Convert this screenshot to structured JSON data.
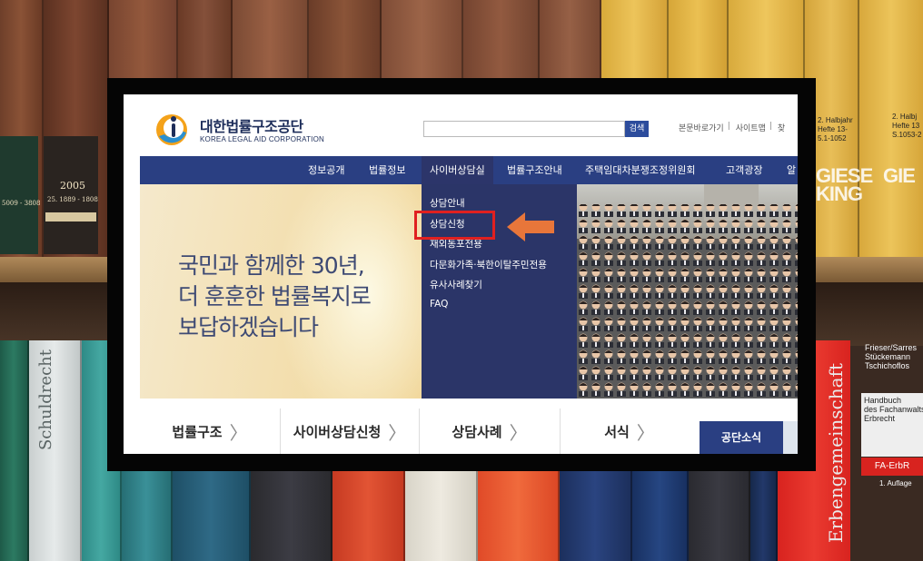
{
  "site": {
    "name_kr": "대한법률구조공단",
    "name_en": "KOREA LEGAL AID CORPORATION"
  },
  "search": {
    "button_label": "검색",
    "placeholder": ""
  },
  "util_links": [
    "본문바로가기",
    "사이트맵",
    "찾"
  ],
  "nav": [
    {
      "label": "정보공개"
    },
    {
      "label": "법률정보"
    },
    {
      "label": "사이버상담실",
      "active": true
    },
    {
      "label": "법률구조안내"
    },
    {
      "label": "주택임대차분쟁조정위원회"
    },
    {
      "label": "고객광장"
    },
    {
      "label": "알"
    }
  ],
  "dropdown": [
    {
      "label": "상담안내"
    },
    {
      "label": "상담신청",
      "highlighted": true
    },
    {
      "label": "재외동포전용"
    },
    {
      "label": "다문화가족·북한이탈주민전용"
    },
    {
      "label": "유사사례찾기"
    },
    {
      "label": "FAQ"
    }
  ],
  "banner": {
    "lines": [
      "국민과 함께한 30년,",
      "더 훈훈한 법률복지로",
      "보답하겠습니다"
    ]
  },
  "tabs": [
    {
      "label": "법률구조"
    },
    {
      "label": "사이버상담신청"
    },
    {
      "label": "상담사례"
    },
    {
      "label": "서식"
    }
  ],
  "notice_tab": "공단소식",
  "colors": {
    "nav_bg": "#2a3f82",
    "dropdown_bg": "#2b3568",
    "highlight": "#e02020",
    "arrow": "#e8763a"
  },
  "background": {
    "shelf_labels": {
      "book_a": "2005",
      "book_a_sub": "25. 1889 - 1808",
      "book_b": "5009 - 3808",
      "giese": "GIESE\nKING",
      "giese2": "GIE",
      "halbjahr": "2. Halbjahr\nHefte 13-\n5.1-1052",
      "halbjahr2": "2. Halbj\nHefte 13\nS.1053-2",
      "schuldrecht": "Schuldrecht",
      "erbengemeinschaft": "Erbengemeinschaft",
      "erb_top": "Frieser/Sarres\nStückemann\nTschichoflos",
      "erb_label": "Handbuch\ndes Fachanwalts\nErbrecht",
      "erb_sub": "FA-ErbR",
      "erb_ed": "1. Auflage"
    }
  }
}
